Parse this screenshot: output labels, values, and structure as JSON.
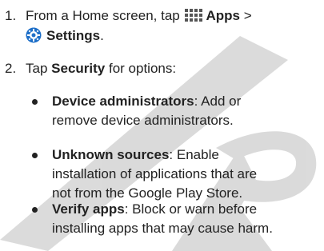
{
  "steps": [
    {
      "number": "1.",
      "prefix": "From a Home screen, tap",
      "apps_label": "Apps",
      "separator": ">",
      "settings_label": "Settings",
      "suffix": "."
    },
    {
      "number": "2.",
      "prefix": "Tap",
      "bold": "Security",
      "suffix": "for options:"
    }
  ],
  "bullets": [
    {
      "term": "Device administrators",
      "line1": ": Add or",
      "line2": "remove device administrators."
    },
    {
      "term": "Unknown sources",
      "line1": ": Enable",
      "line2": "installation of applications that are",
      "line3": "not from the Google Play Store."
    },
    {
      "term": "Verify apps",
      "line1": ": Block or warn before",
      "line2": "installing apps that may cause harm."
    }
  ],
  "colors": {
    "text": "#222222",
    "watermark": "#c8c8c8",
    "settings_icon": "#1e6fc8"
  }
}
